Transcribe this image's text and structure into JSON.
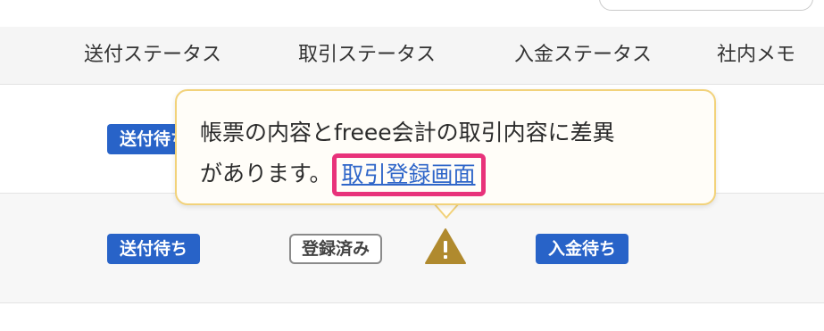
{
  "table": {
    "columns": [
      "送付ステータス",
      "取引ステータス",
      "入金ステータス",
      "社内メモ"
    ],
    "rows": [
      {
        "send_status": "送付待ち"
      },
      {
        "send_status": "送付待ち",
        "deal_status": "登録済み",
        "payment_status": "入金待ち"
      }
    ]
  },
  "tooltip": {
    "message_line1": "帳票の内容とfreee会計の取引内容に差異",
    "message_line2": "があります。",
    "link_label": "取引登録画面"
  },
  "icons": {
    "warning": "warning-triangle-icon"
  },
  "colors": {
    "badge_blue": "#2863c8",
    "warning_gold": "#b08a2e",
    "tooltip_border": "#f2d27a",
    "highlight_pink": "#e8327a",
    "link_blue": "#2f66c9"
  }
}
